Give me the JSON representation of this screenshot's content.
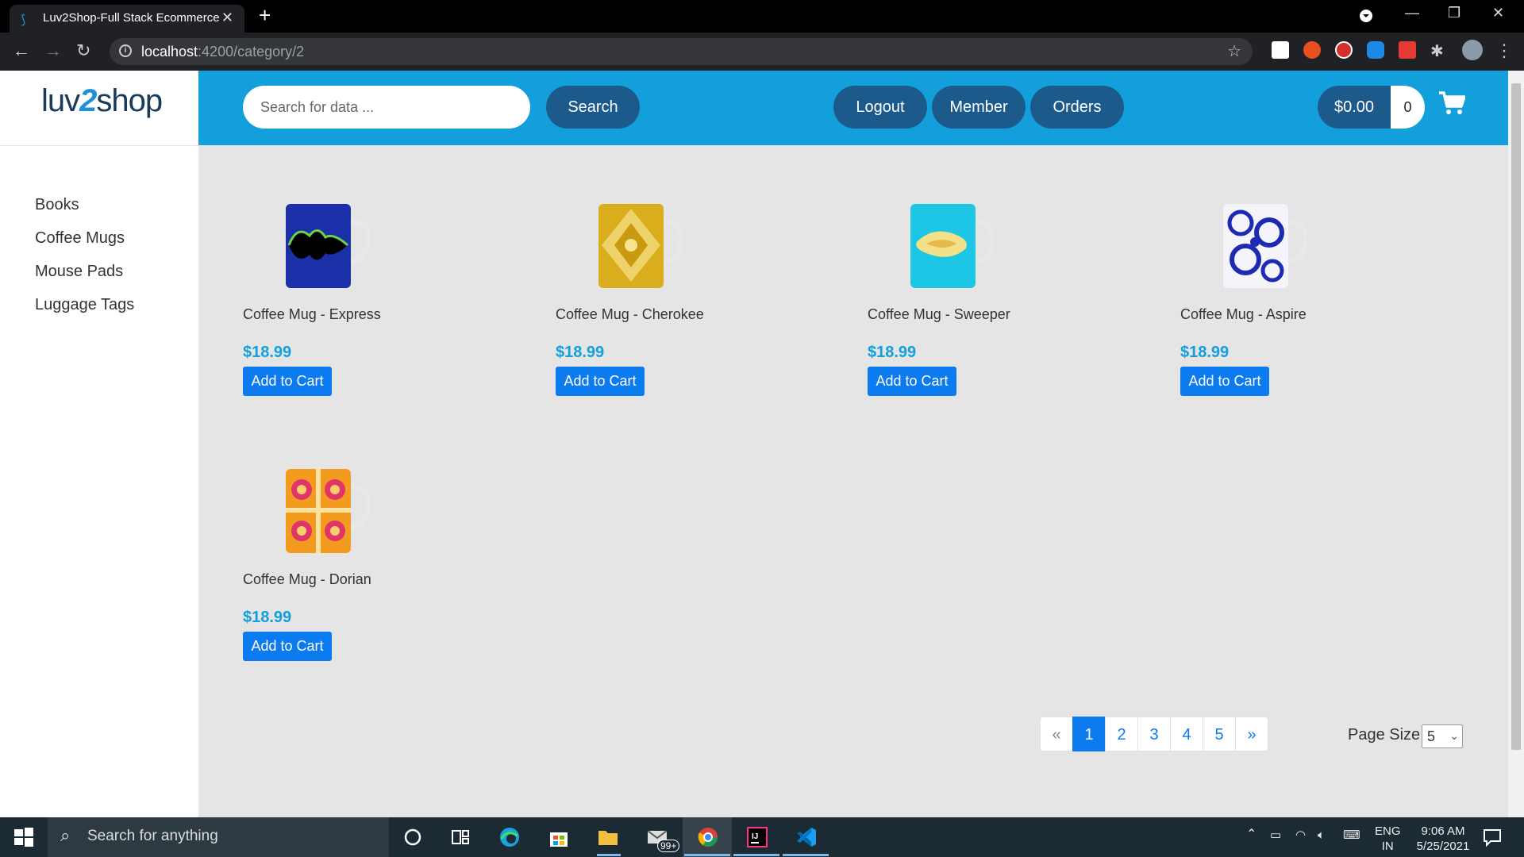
{
  "browser": {
    "tab_title": "Luv2Shop-Full Stack Ecommerce",
    "url_host": "localhost",
    "url_path": ":4200/category/2"
  },
  "site": {
    "logo_left": "luv",
    "logo_mid": "2",
    "logo_right": "shop",
    "categories": [
      "Books",
      "Coffee Mugs",
      "Mouse Pads",
      "Luggage Tags"
    ],
    "search_placeholder": "Search for data ...",
    "search_label": "Search",
    "logout_label": "Logout",
    "member_label": "Member",
    "orders_label": "Orders",
    "cart_total": "$0.00",
    "cart_quantity": "0"
  },
  "products": [
    {
      "name": "Coffee Mug - Express",
      "price": "$18.99",
      "button": "Add to Cart",
      "pattern": "express"
    },
    {
      "name": "Coffee Mug - Cherokee",
      "price": "$18.99",
      "button": "Add to Cart",
      "pattern": "cherokee"
    },
    {
      "name": "Coffee Mug - Sweeper",
      "price": "$18.99",
      "button": "Add to Cart",
      "pattern": "sweeper"
    },
    {
      "name": "Coffee Mug - Aspire",
      "price": "$18.99",
      "button": "Add to Cart",
      "pattern": "aspire"
    },
    {
      "name": "Coffee Mug - Dorian",
      "price": "$18.99",
      "button": "Add to Cart",
      "pattern": "dorian"
    }
  ],
  "pagination": {
    "prev": "«",
    "pages": [
      "1",
      "2",
      "3",
      "4",
      "5"
    ],
    "next": "»",
    "active": "1"
  },
  "page_size": {
    "label": "Page Size",
    "value": "5"
  },
  "taskbar": {
    "search_text": "Search for anything",
    "mail_badge": "99+",
    "lang_top": "ENG",
    "lang_bottom": "IN",
    "time": "9:06 AM",
    "date": "5/25/2021"
  },
  "colors": {
    "header_blue": "#129fdb",
    "pill_dark": "#1d5a8c",
    "button_blue": "#0d7bf0",
    "price_blue": "#129fdb"
  }
}
